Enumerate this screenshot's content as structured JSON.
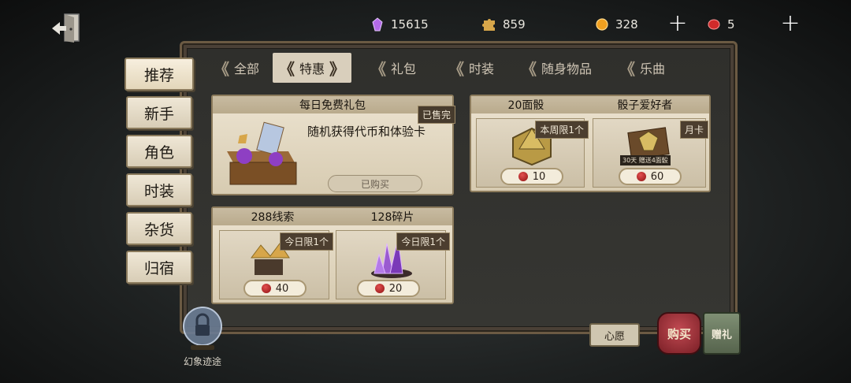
{
  "currencies": [
    {
      "name": "purple-gem",
      "value": "15615",
      "color": "#b36ae6"
    },
    {
      "name": "puzzle-piece",
      "value": "859",
      "color": "#d7a64a"
    },
    {
      "name": "gold-coin",
      "value": "328",
      "color": "#f0a020"
    },
    {
      "name": "red-gem",
      "value": "5",
      "color": "#d02a2a"
    }
  ],
  "tabs": [
    {
      "label": "全部",
      "active": false
    },
    {
      "label": "特惠",
      "active": true
    },
    {
      "label": "礼包",
      "active": false
    },
    {
      "label": "时装",
      "active": false
    },
    {
      "label": "随身物品",
      "active": false
    },
    {
      "label": "乐曲",
      "active": false
    }
  ],
  "sidebar": [
    {
      "label": "推荐",
      "active": true
    },
    {
      "label": "新手",
      "active": false
    },
    {
      "label": "角色",
      "active": false
    },
    {
      "label": "时装",
      "active": false
    },
    {
      "label": "杂货",
      "active": false
    },
    {
      "label": "归宿",
      "active": false
    }
  ],
  "cards": {
    "daily": {
      "title": "每日免费礼包",
      "badge": "已售完",
      "desc": "随机获得代币和体验卡",
      "button": "已购买"
    },
    "dice": {
      "items": [
        {
          "title": "20面骰",
          "badge": "本周限1个",
          "price": "10"
        },
        {
          "title": "骰子爱好者",
          "badge": "月卡",
          "sub": "30天 赠送4面骰",
          "price": "60"
        }
      ]
    },
    "fragments": {
      "items": [
        {
          "title": "288线索",
          "badge": "今日限1个",
          "price": "40"
        },
        {
          "title": "128碎片",
          "badge": "今日限1个",
          "price": "20"
        }
      ]
    }
  },
  "bottom": {
    "crystal_label": "幻象迹途",
    "wish": "心愿",
    "buy": "购买",
    "gift": "赠礼"
  },
  "colors": {
    "accent": "#d9cfbc",
    "panel": "#363632",
    "price_gem": "#c01f1f"
  }
}
